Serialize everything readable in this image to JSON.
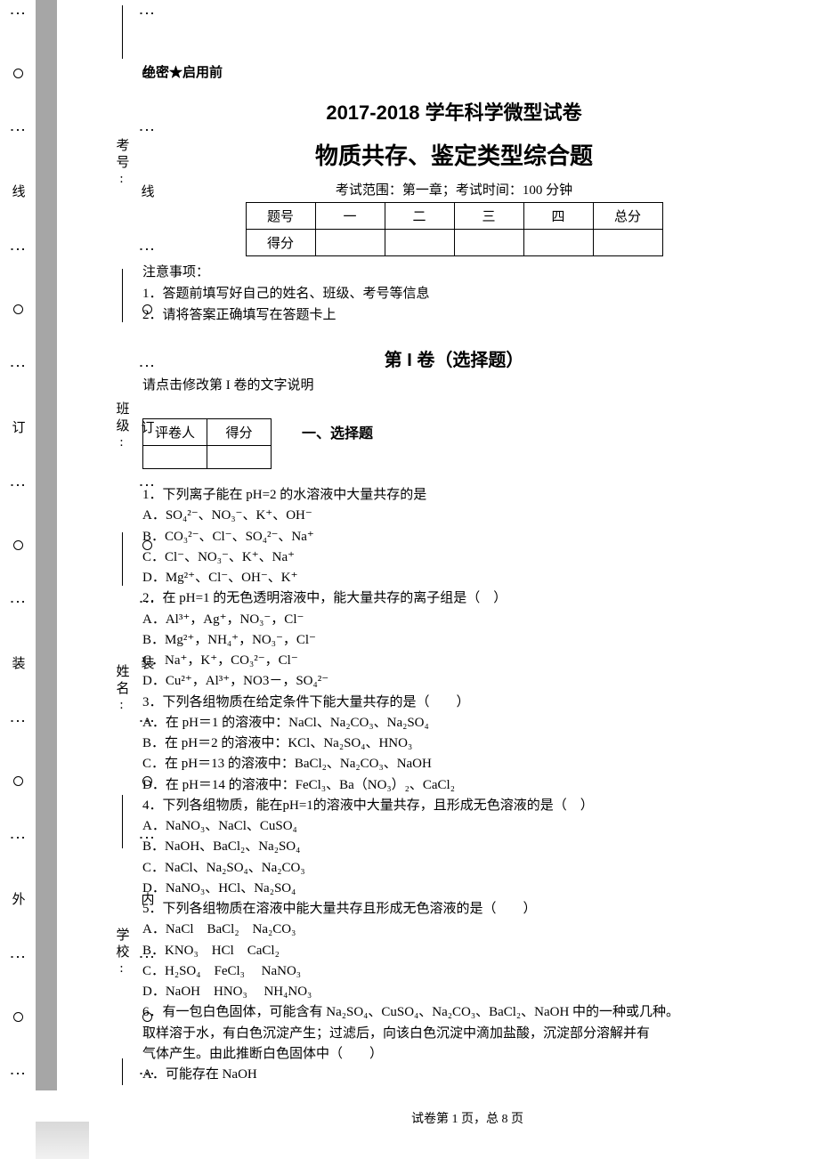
{
  "meta": {
    "confidential": "绝密★启用前",
    "title_line1": "2017-2018 学年科学微型试卷",
    "title_line2": "物质共存、鉴定类型综合题",
    "scope": "考试范围：第一章；考试时间：100 分钟",
    "footer": "试卷第 1 页，总 8 页"
  },
  "gutter": {
    "outer_labels": [
      "外",
      "装",
      "订",
      "线"
    ],
    "inner_labels": [
      "内",
      "装",
      "订",
      "线"
    ],
    "fields": [
      "学校:",
      "姓名:",
      "班级:",
      "考号:"
    ]
  },
  "score_table": {
    "headers": [
      "题号",
      "一",
      "二",
      "三",
      "四",
      "总分"
    ],
    "row_label": "得分"
  },
  "notes": {
    "heading": "注意事项：",
    "n1": "1．答题前填写好自己的姓名、班级、考号等信息",
    "n2": "2．请将答案正确填写在答题卡上"
  },
  "part1": {
    "title": "第 I 卷（选择题）",
    "hint": "请点击修改第 I 卷的文字说明",
    "grader_h1": "评卷人",
    "grader_h2": "得分",
    "section": "一、选择题"
  },
  "q": {
    "q1": "1．下列离子能在 pH=2 的水溶液中大量共存的是",
    "q1a": "A．SO₄²⁻、NO₃⁻、K⁺、OH⁻",
    "q1b": "B．CO₃²⁻、Cl⁻、SO₄²⁻、Na⁺",
    "q1c": "C．Cl⁻、NO₃⁻、K⁺、Na⁺",
    "q1d": "D．Mg²⁺、Cl⁻、OH⁻、K⁺",
    "q2": "2．在 pH=1 的无色透明溶液中，能大量共存的离子组是（　）",
    "q2a": "A．Al³⁺，Ag⁺，NO₃⁻，Cl⁻",
    "q2b": "B．Mg²⁺，NH₄⁺，NO₃⁻，Cl⁻",
    "q2c": "C．Na⁺，K⁺，CO₃²⁻，Cl⁻",
    "q2d": "D．Cu²⁺，Al³⁺，NO3－，SO₄²⁻",
    "q3": "3．下列各组物质在给定条件下能大量共存的是（　　）",
    "q3a": "A．在 pH＝1 的溶液中：NaCl、Na₂CO₃、Na₂SO₄",
    "q3b": "B．在 pH＝2 的溶液中：KCl、Na₂SO₄、HNO₃",
    "q3c": "C．在 pH＝13 的溶液中：BaCl₂、Na₂CO₃、NaOH",
    "q3d": "D．在 pH＝14 的溶液中：FeCl₃、Ba（NO₃）₂、CaCl₂",
    "q4": "4．下列各组物质，能在pH=1的溶液中大量共存，且形成无色溶液的是（　）",
    "q4a": "A．NaNO₃、NaCl、CuSO₄",
    "q4b": "B．NaOH、BaCl₂、Na₂SO₄",
    "q4c": "C．NaCl、Na₂SO₄、Na₂CO₃",
    "q4d": "D．NaNO₃、HCl、Na₂SO₄",
    "q5": "5．下列各组物质在溶液中能大量共存且形成无色溶液的是（　　）",
    "q5a": "A．NaCl　BaCl₂　Na₂CO₃",
    "q5b": "B．KNO₃　HCl　CaCl₂",
    "q5c": "C．H₂SO₄　FeCl₃　 NaNO₃",
    "q5d": "D．NaOH　HNO₃　 NH₄NO₃",
    "q6a": "6．有一包白色固体，可能含有 Na₂SO₄、CuSO₄、Na₂CO₃、BaCl₂、NaOH 中的一种或几种。",
    "q6b": "取样溶于水，有白色沉淀产生；过滤后，向该白色沉淀中滴加盐酸，沉淀部分溶解并有",
    "q6c": "气体产生。由此推断白色固体中（　　）",
    "q6d": "A．可能存在 NaOH"
  }
}
